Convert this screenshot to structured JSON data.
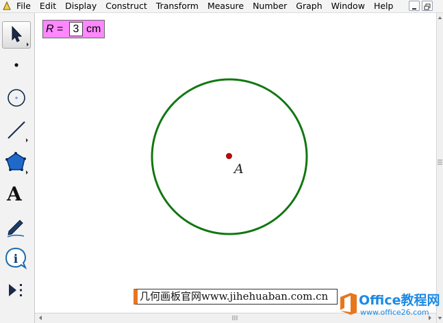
{
  "menu": {
    "items": [
      "File",
      "Edit",
      "Display",
      "Construct",
      "Transform",
      "Measure",
      "Number",
      "Graph",
      "Window",
      "Help"
    ]
  },
  "toolbox": {
    "tools": [
      {
        "name": "arrow-select-tool",
        "active": true
      },
      {
        "name": "point-tool",
        "active": false
      },
      {
        "name": "compass-tool",
        "active": false
      },
      {
        "name": "straightedge-tool",
        "active": false
      },
      {
        "name": "polygon-tool",
        "active": false
      },
      {
        "name": "text-tool",
        "active": false,
        "glyph": "A"
      },
      {
        "name": "marker-tool",
        "active": false
      },
      {
        "name": "information-tool",
        "active": false
      },
      {
        "name": "custom-tools",
        "active": false
      }
    ]
  },
  "parameter": {
    "name": "R",
    "equals": "=",
    "value": "3",
    "unit": "cm",
    "color": "#ff88ff"
  },
  "sketch": {
    "center_label": "A",
    "radius_cm": 3,
    "circle_color": "#117711",
    "point_color": "#cc0000"
  },
  "watermark": {
    "site_text": "几何画板官网www.jihehuaban.com.cn",
    "brand": "Office教程网",
    "brand_url": "www.office26.com",
    "brand_color": "#1c8ae6",
    "accent_color": "#e8761c"
  }
}
